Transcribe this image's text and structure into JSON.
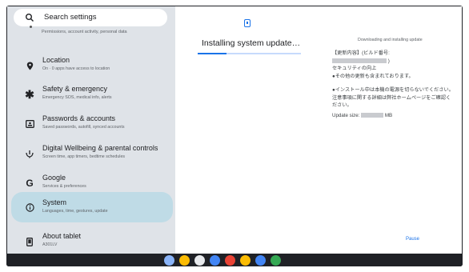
{
  "search": {
    "placeholder": "Search settings"
  },
  "sidebar": {
    "top_partial_subtitle": "Permissions, account activity, personal data",
    "items": [
      {
        "title": "Location",
        "subtitle": "On · 0 apps have access to location",
        "icon": "location-pin-icon"
      },
      {
        "title": "Safety & emergency",
        "subtitle": "Emergency SOS, medical info, alerts",
        "icon": "asterisk-icon"
      },
      {
        "title": "Passwords & accounts",
        "subtitle": "Saved passwords, autofill, synced accounts",
        "icon": "account-card-icon"
      },
      {
        "title": "Digital Wellbeing & parental controls",
        "subtitle": "Screen time, app timers, bedtime schedules",
        "icon": "wellbeing-icon"
      },
      {
        "title": "Google",
        "subtitle": "Services & preferences",
        "icon": "google-g-icon"
      },
      {
        "title": "System",
        "subtitle": "Languages, time, gestures, update",
        "icon": "info-icon",
        "selected": true
      },
      {
        "title": "About tablet",
        "subtitle": "A301LV",
        "icon": "tablet-icon"
      }
    ]
  },
  "main": {
    "title": "Installing system update…",
    "progress_fraction": 0.28,
    "status": "Downloading and installing update",
    "notes": {
      "line1": "【更新内容】(ビルド番号:",
      "line2": ")",
      "line3": "セキュリティの向上",
      "line4": "●その他の更新も含まれております。",
      "line5": "●インストール中は本機の電源を切らないでください。",
      "line6": "注意事項に関する詳細は弊社ホームページをご確認ください。",
      "size_label": "Update size:",
      "size_unit": "MB"
    },
    "pause_label": "Pause"
  },
  "taskbar": {
    "apps": [
      {
        "name": "files-app-icon",
        "color": "#8ab4f8"
      },
      {
        "name": "chrome-app-icon",
        "color": "#fbbc04"
      },
      {
        "name": "camera-app-icon",
        "color": "#e8eaed"
      },
      {
        "name": "settings-app-icon",
        "color": "#4285f4"
      },
      {
        "name": "play-store-app-icon",
        "color": "#ea4335"
      },
      {
        "name": "photos-app-icon",
        "color": "#fbbc04"
      },
      {
        "name": "assistant-app-icon",
        "color": "#4285f4"
      },
      {
        "name": "apps-launcher-icon",
        "color": "#34a853"
      }
    ]
  }
}
